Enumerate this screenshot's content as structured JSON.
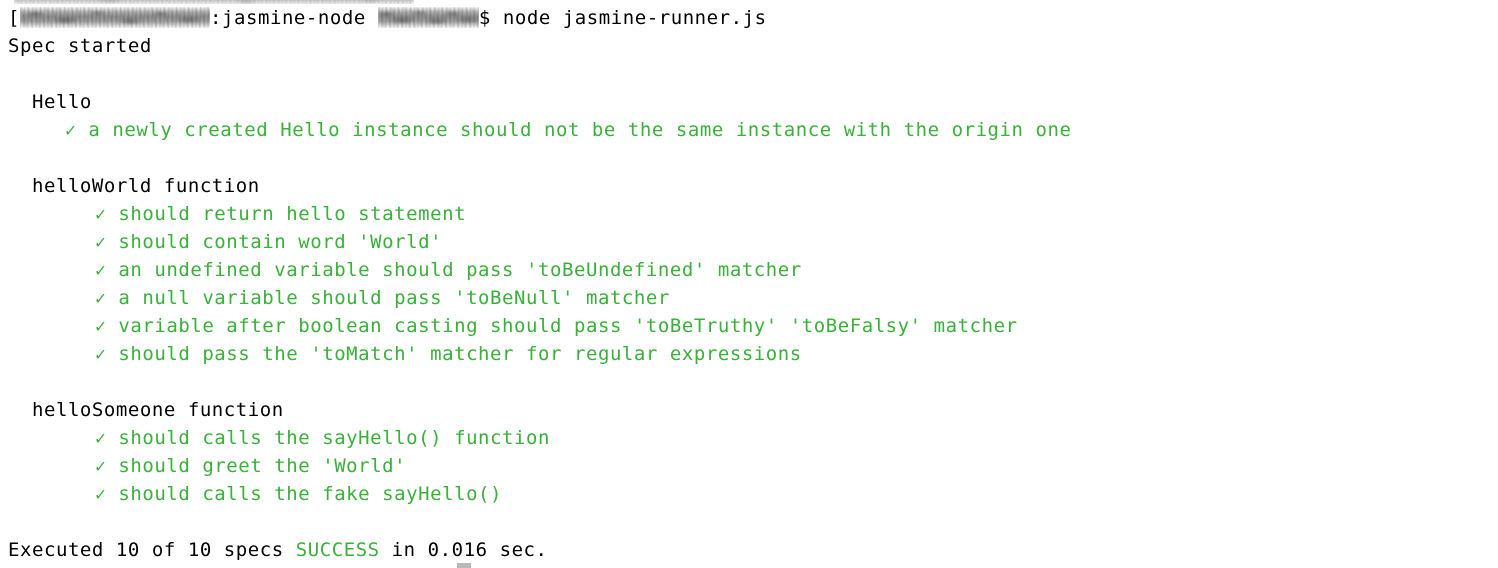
{
  "terminal": {
    "background_color": "#ffffff",
    "foreground_color": "#000000",
    "pass_color": "#3ab03a",
    "redaction_color": "#868686",
    "prompt": {
      "open_bracket": "[",
      "user_host_redacted": "",
      "separator": ":",
      "directory": "jasmine-node",
      "branch_redacted": "",
      "sigil": "$",
      "command": " node jasmine-runner.js"
    },
    "lines": [
      {
        "id": "spec-started",
        "text": "Spec started",
        "style": "plain"
      },
      {
        "id": "blank-1",
        "text": "",
        "style": "plain"
      },
      {
        "id": "suite-hello",
        "text": "  Hello",
        "style": "plain"
      },
      {
        "id": "spec-1",
        "mark": "✓",
        "text": "a newly created Hello instance should not be the same instance with the origin one",
        "style": "pass"
      },
      {
        "id": "blank-2",
        "text": "",
        "style": "plain"
      },
      {
        "id": "suite-helloworld",
        "text": "  helloWorld function",
        "style": "plain"
      },
      {
        "id": "spec-2",
        "mark": "✓",
        "text": "should return hello statement",
        "style": "pass"
      },
      {
        "id": "spec-3",
        "mark": "✓",
        "text": "should contain word 'World'",
        "style": "pass"
      },
      {
        "id": "spec-4",
        "mark": "✓",
        "text": "an undefined variable should pass 'toBeUndefined' matcher",
        "style": "pass"
      },
      {
        "id": "spec-5",
        "mark": "✓",
        "text": "a null variable should pass 'toBeNull' matcher",
        "style": "pass"
      },
      {
        "id": "spec-6",
        "mark": "✓",
        "text": "variable after boolean casting should pass 'toBeTruthy' 'toBeFalsy' matcher",
        "style": "pass"
      },
      {
        "id": "spec-7",
        "mark": "✓",
        "text": "should pass the 'toMatch' matcher for regular expressions",
        "style": "pass"
      },
      {
        "id": "blank-3",
        "text": "",
        "style": "plain"
      },
      {
        "id": "suite-hellosomeone",
        "text": "  helloSomeone function",
        "style": "plain"
      },
      {
        "id": "spec-8",
        "mark": "✓",
        "text": "should calls the sayHello() function",
        "style": "pass"
      },
      {
        "id": "spec-9",
        "mark": "✓",
        "text": "should greet the 'World'",
        "style": "pass"
      },
      {
        "id": "spec-10",
        "mark": "✓",
        "text": "should calls the fake sayHello()",
        "style": "pass"
      }
    ],
    "summary": {
      "prefix": "Executed 10 of 10 specs ",
      "status": "SUCCESS",
      "suffix": " in 0.016 sec.",
      "executed_count": 10,
      "total_count": 10,
      "duration_seconds": "0.016"
    }
  }
}
